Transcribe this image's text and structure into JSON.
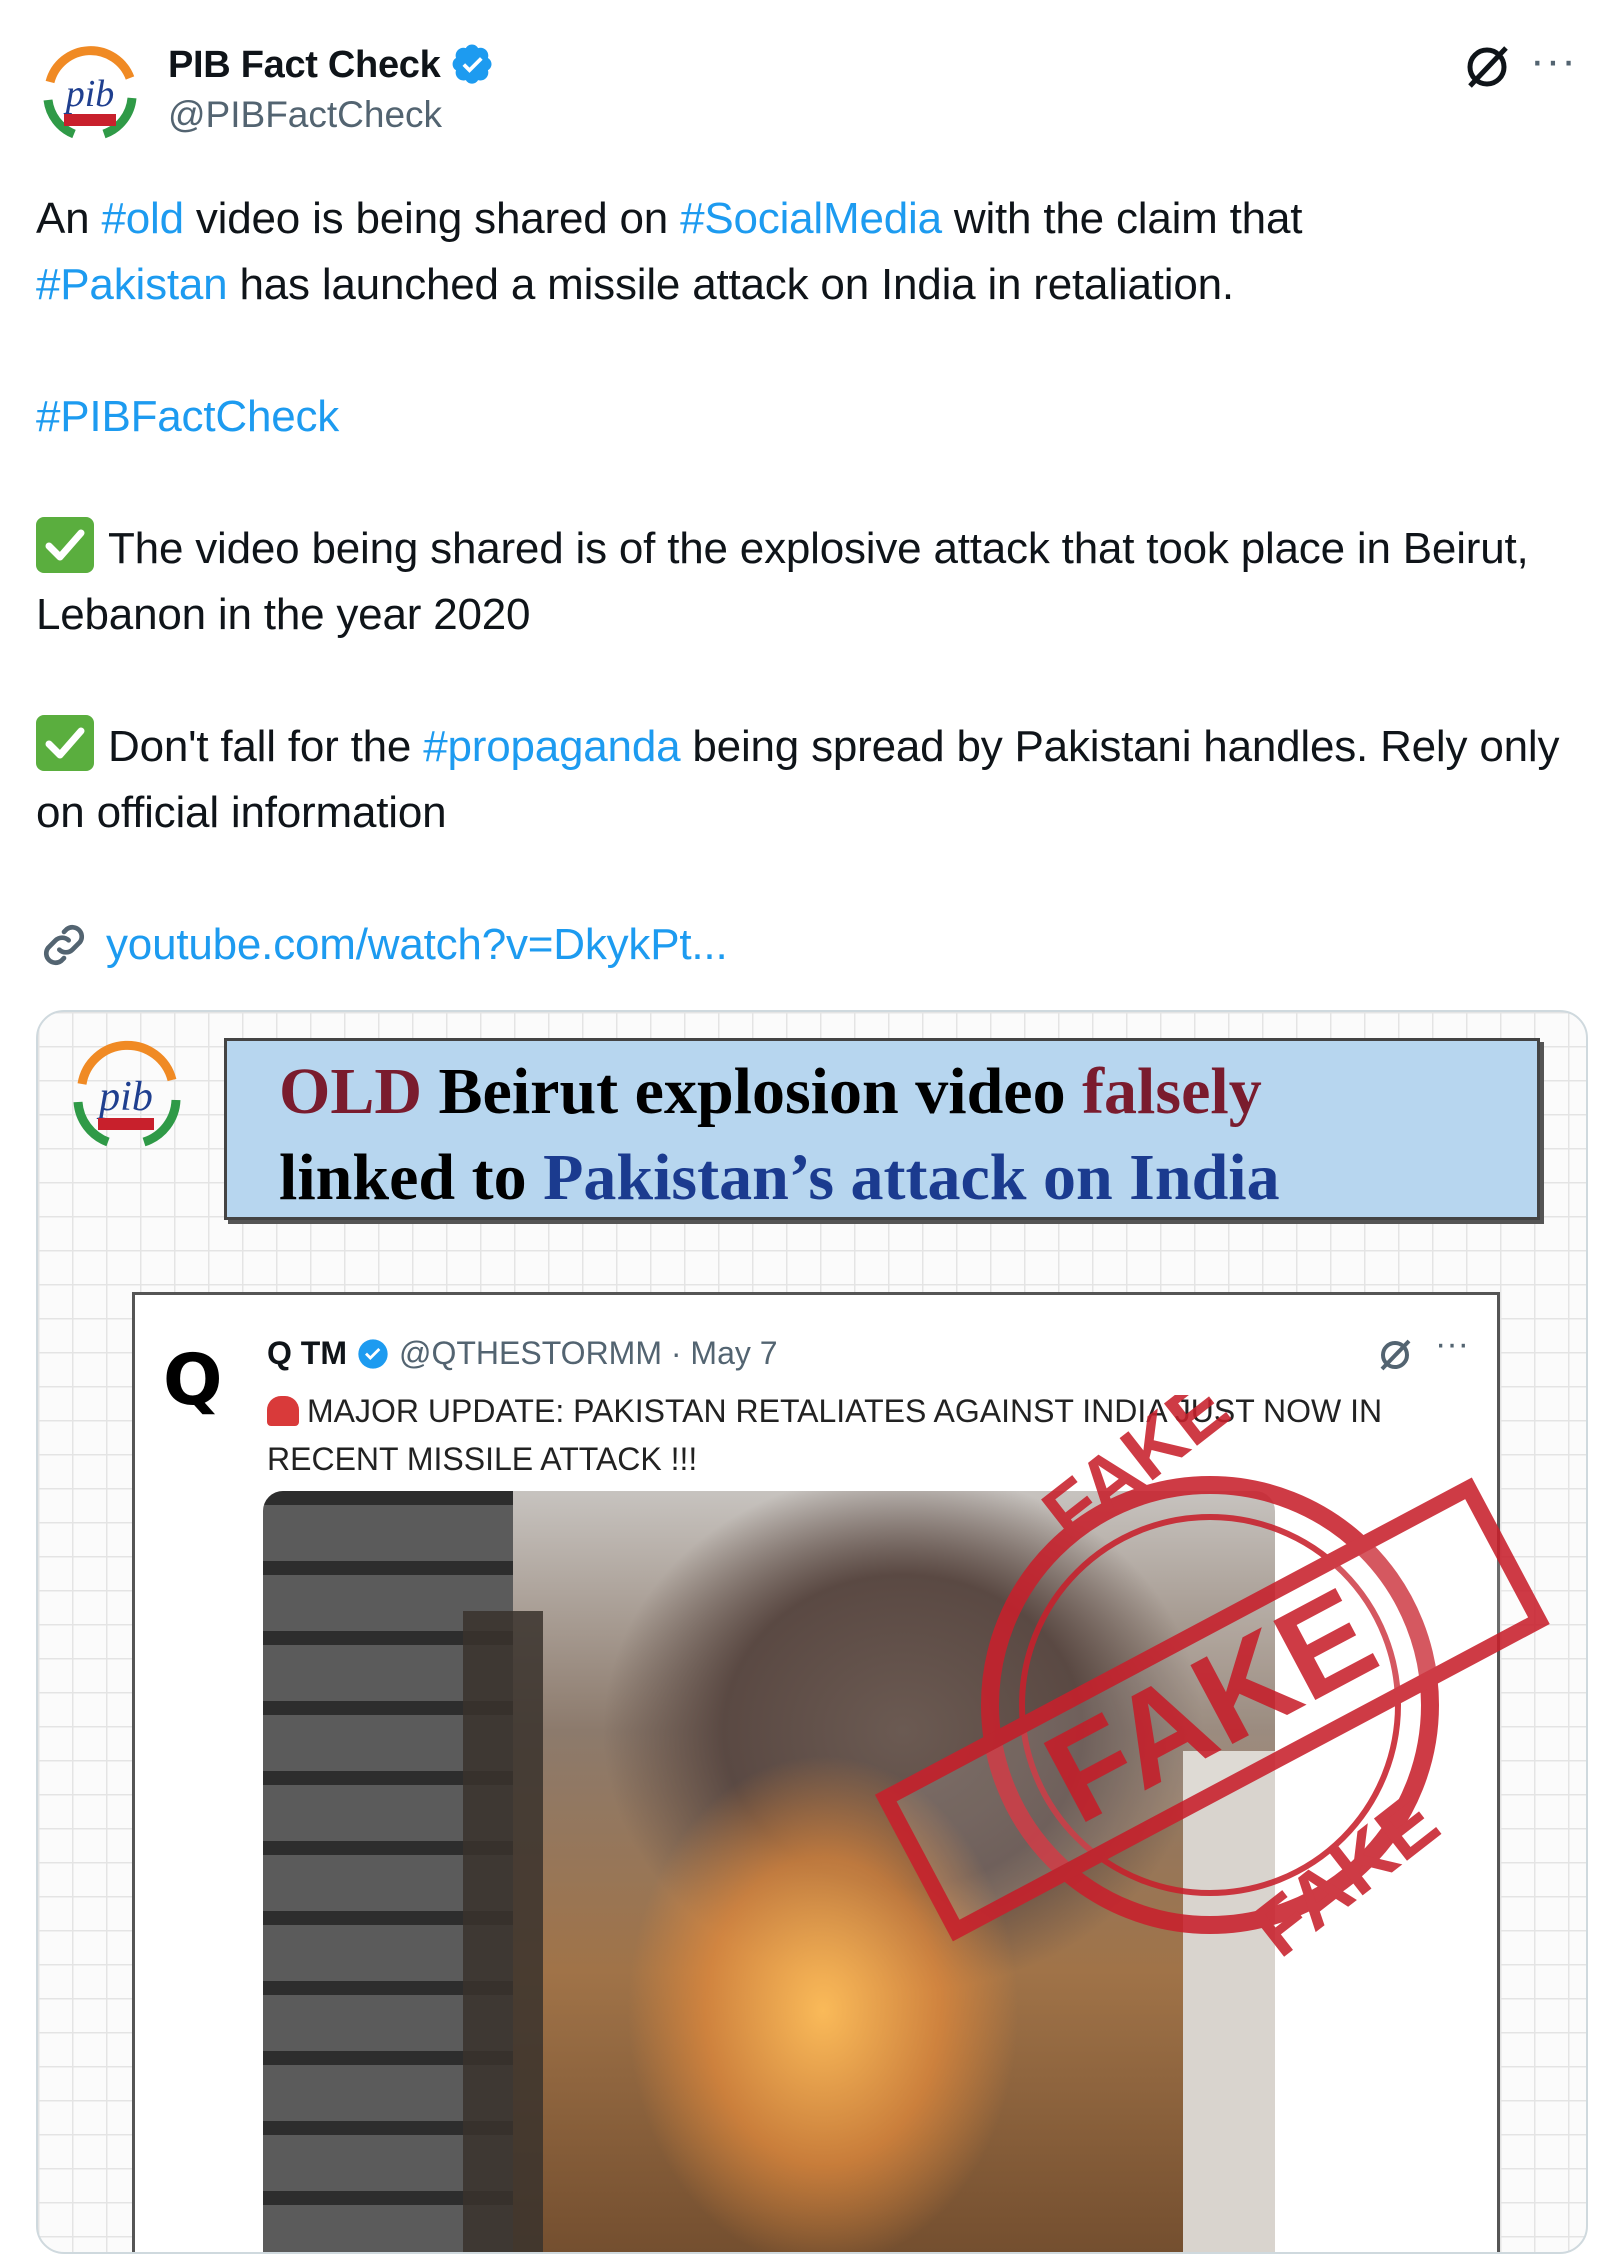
{
  "account": {
    "display_name": "PIB Fact Check",
    "handle": "@PIBFactCheck",
    "avatar_icon": "pib-logo-icon",
    "verified_icon": "verified-badge-icon"
  },
  "tweet": {
    "line1": {
      "part1": "An ",
      "tag_old": "#old",
      "part2": " video is being shared on ",
      "tag_social": "#SocialMedia",
      "part3": " with the claim that "
    },
    "line2": {
      "tag_pakistan": "#Pakistan",
      "part1": " has launched a missile attack on India in retaliation."
    },
    "hashtag": "#PIBFactCheck",
    "point1": "The video being shared is of the explosive attack that took place in Beirut, Lebanon in the year 2020",
    "point2": {
      "part1": "Don't fall for the ",
      "tag": "#propaganda",
      "part2": " being spread by Pakistani handles. Rely only on official information"
    },
    "link_text": "youtube.com/watch?v=DkykPt...",
    "link_icon": "link-icon"
  },
  "media": {
    "headline": {
      "word_old": "OLD",
      "part1": " Beirut explosion video ",
      "word_falsely": "falsely",
      "part2": "linked to ",
      "word_attack": "Pakistan’s attack on India"
    },
    "quoted_post": {
      "author": "Q TM",
      "meta": "@QTHESTORMM · May 7",
      "text": "MAJOR UPDATE: PAKISTAN RETALIATES AGAINST INDIA JUST NOW IN RECENT MISSILE ATTACK !!!",
      "logo_letter": "Q"
    },
    "stamp_text": "FAKE"
  },
  "colors": {
    "link_blue": "#1d9bf0",
    "stamp_red": "#c8202c",
    "headline_bg": "#b7d6ef"
  }
}
